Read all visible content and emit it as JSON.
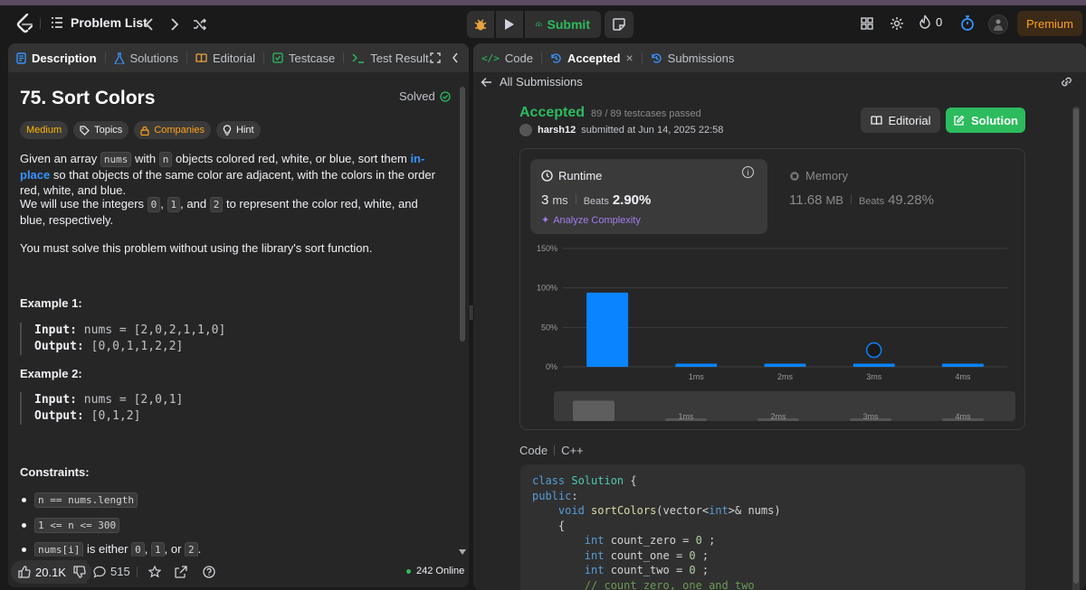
{
  "nav": {
    "problem_list": "Problem List",
    "submit": "Submit",
    "streak": "0",
    "premium": "Premium"
  },
  "left": {
    "tabs": [
      "Description",
      "Solutions",
      "Editorial",
      "Testcase",
      "Test Result"
    ],
    "title": "75. Sort Colors",
    "solved": "Solved",
    "tags": {
      "difficulty": "Medium",
      "topics": "Topics",
      "companies": "Companies",
      "hint": "Hint"
    },
    "p1": {
      "a": "Given an array",
      "nums": "nums",
      "b": "with",
      "n": "n",
      "c": "objects colored red, white, or blue, sort them",
      "link": "in-place",
      "d": "so that",
      "e": "objects of the same color are adjacent, with the colors in the order red, white, and blue."
    },
    "p2": {
      "a": "We will use the integers",
      "z": "0",
      "o": "1",
      "and": ", and",
      "t": "2",
      "b": "to represent the color red, white, and blue,",
      "c": "respectively."
    },
    "p3": "You must solve this problem without using the library's sort function.",
    "example1": {
      "title": "Example 1:",
      "input_label": "Input:",
      "input": "nums = [2,0,2,1,1,0]",
      "output_label": "Output:",
      "output": "[0,0,1,1,2,2]"
    },
    "example2": {
      "title": "Example 2:",
      "input_label": "Input:",
      "input": "nums = [2,0,1]",
      "output_label": "Output:",
      "output": "[0,1,2]"
    },
    "constraints_title": "Constraints:",
    "constraints": {
      "c1": "n == nums.length",
      "c2": "1 <= n <= 300",
      "c3a": "nums[i]",
      "c3b": "is either",
      "c3z": "0",
      "c3o": "1",
      "c3or": ", or",
      "c3t": "2"
    },
    "likes": "20.1K",
    "comments": "515",
    "online": "242 Online"
  },
  "right": {
    "tabs": [
      "Code",
      "Accepted",
      "Submissions"
    ],
    "back": "All Submissions",
    "status": "Accepted",
    "passed": "89 / 89 testcases passed",
    "user": "harsh12",
    "submitted": "submitted at Jun 14, 2025 22:58",
    "editorial": "Editorial",
    "solution": "Solution",
    "runtime_label": "Runtime",
    "runtime_value": "3",
    "runtime_unit": "ms",
    "beats_label": "Beats",
    "runtime_beats": "2.90%",
    "analyze": "Analyze Complexity",
    "memory_label": "Memory",
    "memory_value": "11.68",
    "memory_unit": "MB",
    "memory_beats": "49.28%",
    "code_label": "Code",
    "lang": "C++"
  },
  "chart_data": {
    "type": "bar",
    "categories": [
      "",
      "1ms",
      "2ms",
      "3ms",
      "4ms"
    ],
    "values": [
      94,
      4,
      4,
      4,
      4
    ],
    "y_ticks": [
      "150%",
      "100%",
      "50%",
      "0%"
    ],
    "ylim": [
      0,
      150
    ],
    "marker_category": "3ms",
    "grid": true,
    "color": "#0a84ff"
  },
  "code_lines": [
    "class Solution {",
    "public:",
    "    void sortColors(vector<int>& nums)",
    "    {",
    "        int count_zero = 0 ;",
    "        int count_one = 0 ;",
    "        int count_two = 0 ;",
    "        // count zero, one and two"
  ]
}
